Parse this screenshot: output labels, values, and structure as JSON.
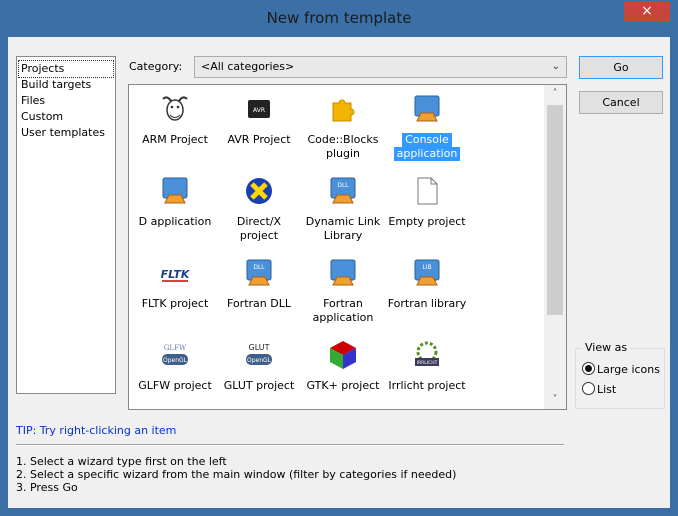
{
  "window": {
    "title": "New from template",
    "close_glyph": "×"
  },
  "left_list": [
    "Projects",
    "Build targets",
    "Files",
    "Custom",
    "User templates"
  ],
  "category": {
    "label": "Category:",
    "value": "<All categories>"
  },
  "templates": [
    {
      "label_lines": [
        "ARM Project"
      ],
      "icon": "gnu-icon"
    },
    {
      "label_lines": [
        "AVR Project"
      ],
      "icon": "avr-chip-icon"
    },
    {
      "label_lines": [
        "Code::Blocks",
        "plugin"
      ],
      "icon": "puzzle-plugin-icon"
    },
    {
      "label_lines": [
        "Console",
        "application"
      ],
      "icon": "console-app-icon",
      "selected": true
    },
    {
      "label_lines": [
        "D application"
      ],
      "icon": "d-app-icon"
    },
    {
      "label_lines": [
        "Direct/X",
        "project"
      ],
      "icon": "directx-icon"
    },
    {
      "label_lines": [
        "Dynamic Link",
        "Library"
      ],
      "icon": "dll-icon"
    },
    {
      "label_lines": [
        "Empty project"
      ],
      "icon": "empty-file-icon"
    },
    {
      "label_lines": [
        "FLTK project"
      ],
      "icon": "fltk-icon"
    },
    {
      "label_lines": [
        "Fortran DLL"
      ],
      "icon": "fortran-dll-icon"
    },
    {
      "label_lines": [
        "Fortran",
        "application"
      ],
      "icon": "fortran-app-icon"
    },
    {
      "label_lines": [
        "Fortran library"
      ],
      "icon": "fortran-lib-icon"
    },
    {
      "label_lines": [
        "GLFW project"
      ],
      "icon": "glfw-icon"
    },
    {
      "label_lines": [
        "GLUT project"
      ],
      "icon": "glut-icon"
    },
    {
      "label_lines": [
        "GTK+ project"
      ],
      "icon": "gtk-icon"
    },
    {
      "label_lines": [
        "Irrlicht project"
      ],
      "icon": "irrlicht-icon"
    }
  ],
  "icon_text": {
    "dll": "DLL",
    "lib": "LIB",
    "fltk": "FLTK",
    "glfw": "GLFW",
    "glut": "GLUT",
    "opengl": "OpenGL",
    "irrlicht": "IRRLICHT"
  },
  "buttons": {
    "go": "Go",
    "cancel": "Cancel"
  },
  "view_as": {
    "legend": "View as",
    "options": [
      "Large icons",
      "List"
    ],
    "selected": "Large icons"
  },
  "tip": "TIP: Try right-clicking an item",
  "instructions": [
    "1. Select a wizard type first on the left",
    "2. Select a specific wizard from the main window (filter by categories if needed)",
    "3. Press Go"
  ],
  "colors": {
    "title_bar": "#3b6fa6",
    "selection": "#3399ff",
    "close": "#c7453a",
    "tip_text": "#0033cc"
  }
}
